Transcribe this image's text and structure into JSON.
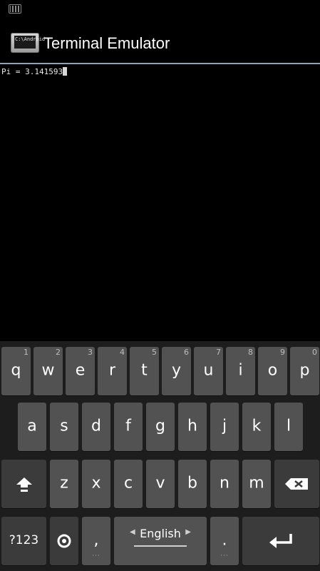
{
  "status_bar": {
    "keyboard_icon": "keyboard-icon"
  },
  "action_bar": {
    "app_icon_text": "C:\\Android",
    "title": "Terminal Emulator"
  },
  "terminal": {
    "line": "Pi = 3.141593"
  },
  "keyboard": {
    "row1": [
      {
        "label": "q",
        "hint": "1"
      },
      {
        "label": "w",
        "hint": "2"
      },
      {
        "label": "e",
        "hint": "3"
      },
      {
        "label": "r",
        "hint": "4"
      },
      {
        "label": "t",
        "hint": "5"
      },
      {
        "label": "y",
        "hint": "6"
      },
      {
        "label": "u",
        "hint": "7"
      },
      {
        "label": "i",
        "hint": "8"
      },
      {
        "label": "o",
        "hint": "9"
      },
      {
        "label": "p",
        "hint": "0"
      }
    ],
    "row2": [
      "a",
      "s",
      "d",
      "f",
      "g",
      "h",
      "j",
      "k",
      "l"
    ],
    "row3": [
      "z",
      "x",
      "c",
      "v",
      "b",
      "n",
      "m"
    ],
    "shift_icon": "shift-icon",
    "backspace_icon": "backspace-icon",
    "symbols_label": "?123",
    "settings_icon": "settings-icon",
    "comma_label": ",",
    "space_label": "English",
    "period_label": ".",
    "enter_icon": "enter-icon"
  }
}
